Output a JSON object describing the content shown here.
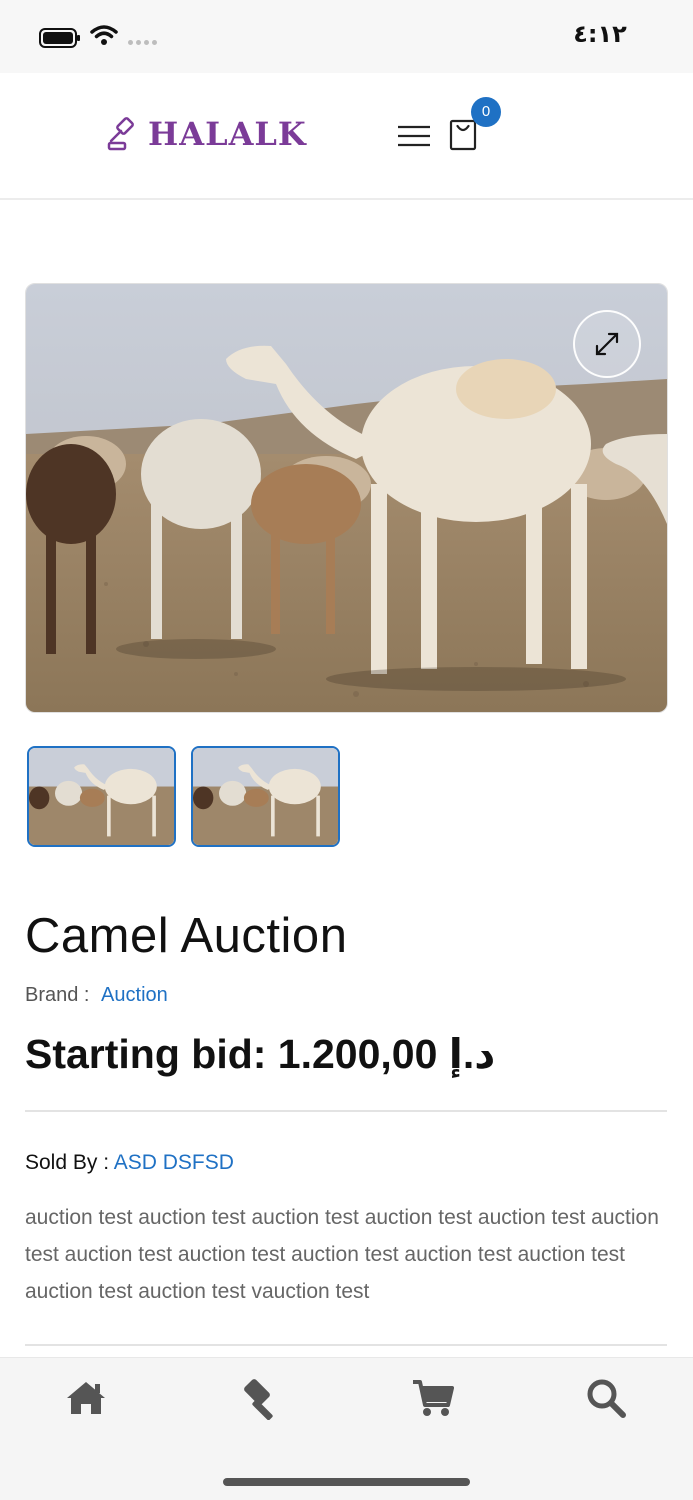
{
  "status_bar": {
    "time": "٤:١٢",
    "icons": [
      "battery-icon",
      "wifi-icon",
      "signal-icon"
    ]
  },
  "header": {
    "logo_text": "HALALK",
    "menu_icon": "hamburger-icon",
    "cart_icon": "shopping-bag-icon",
    "cart_count": "0"
  },
  "gallery": {
    "main_image": "camels-photo",
    "expand_icon": "expand-icon",
    "thumbnails": [
      "camels-photo",
      "camels-photo"
    ]
  },
  "product": {
    "title": "Camel Auction",
    "brand_label": "Brand :",
    "brand_value": "Auction",
    "price_text": "Starting bid: 1.200,00 د.إ",
    "sold_by_label": "Sold By :",
    "sold_by_value": "ASD DSFSD",
    "description": "auction test auction test auction test auction test auction test auction test auction test auction test auction test auction test auction test auction test auction test vauction test"
  },
  "bottom_nav": {
    "items": [
      {
        "icon": "home-icon"
      },
      {
        "icon": "gavel-icon"
      },
      {
        "icon": "cart-icon"
      },
      {
        "icon": "search-icon"
      }
    ]
  },
  "colors": {
    "accent": "#1f71c4",
    "logo": "#7b3b98",
    "text": "#111111",
    "muted": "#666666"
  }
}
